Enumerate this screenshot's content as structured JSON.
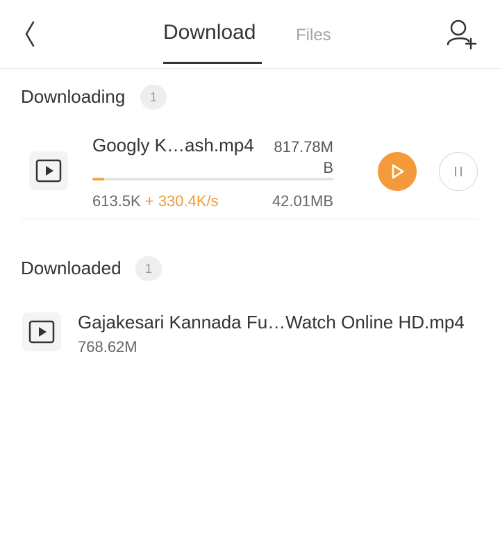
{
  "header": {
    "tabs": [
      {
        "label": "Download",
        "active": true
      },
      {
        "label": "Files",
        "active": false
      }
    ],
    "back_icon": "chevron-left-icon",
    "add_user_icon": "add-user-icon"
  },
  "downloading": {
    "title": "Downloading",
    "count": "1",
    "items": [
      {
        "name": "Googly K…ash.mp4",
        "size_line1": "817.78M",
        "size_line2": "B",
        "downloaded": "613.5K",
        "speed": "+ 330.4K/s",
        "remaining": "42.01MB",
        "progress_fraction": 0.05
      }
    ]
  },
  "downloaded": {
    "title": "Downloaded",
    "count": "1",
    "items": [
      {
        "name": "Gajakesari Kannada Fu…Watch Online HD.mp4",
        "size": "768.62M"
      }
    ]
  },
  "colors": {
    "accent": "#f59a3a",
    "text": "#333333",
    "muted": "#a6a6a6"
  }
}
